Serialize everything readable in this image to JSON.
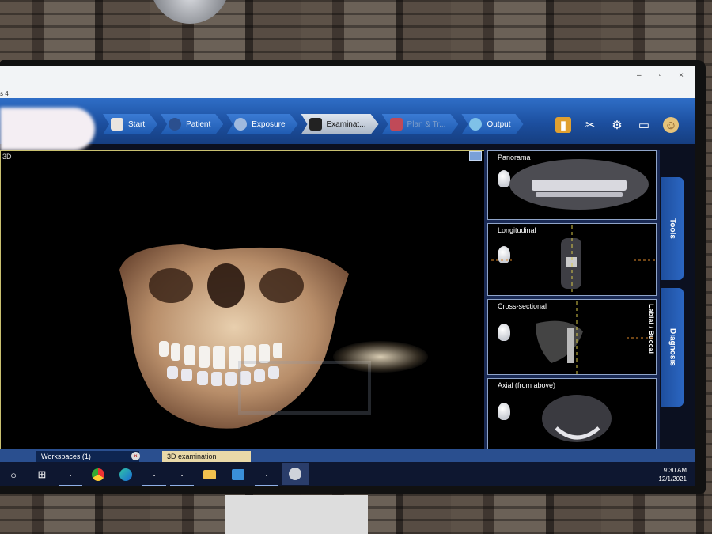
{
  "window": {
    "title_fragment": "s 4",
    "controls": [
      "–",
      "▫",
      "×"
    ]
  },
  "workflow": {
    "steps": [
      {
        "label": "Start",
        "icon": "house-icon",
        "state": "normal"
      },
      {
        "label": "Patient",
        "icon": "patient-icon",
        "state": "normal"
      },
      {
        "label": "Exposure",
        "icon": "exposure-icon",
        "state": "normal"
      },
      {
        "label": "Examinat...",
        "icon": "examination-icon",
        "state": "active"
      },
      {
        "label": "Plan & Tr...",
        "icon": "plan-icon",
        "state": "disabled"
      },
      {
        "label": "Output",
        "icon": "globe-icon",
        "state": "normal"
      }
    ]
  },
  "toolbar_icons": [
    "notes-icon",
    "tools-icon",
    "gear-icon",
    "screens-icon",
    "smiley-icon"
  ],
  "main_view": {
    "label": "3D"
  },
  "panels": [
    {
      "label": "Panorama"
    },
    {
      "label": "Longitudinal"
    },
    {
      "label": "Cross-sectional"
    },
    {
      "label": "Axial (from above)"
    }
  ],
  "side_tabs": {
    "tools": "Tools",
    "diagnosis": "Diagnosis",
    "labial": "Labial / Buccal"
  },
  "workspace_tabs": [
    {
      "label": "Workspaces (1)"
    },
    {
      "label": "3D examination"
    }
  ],
  "taskbar": {
    "time": "9:30 AM",
    "date": "12/1/2021",
    "items": [
      "search-icon",
      "taskview-icon",
      "app-icon",
      "chrome-icon",
      "edge-icon",
      "app-icon",
      "app-icon",
      "folder-icon",
      "monitor-app-icon",
      "app-icon",
      "dental-app-icon"
    ]
  },
  "colors": {
    "workflow_blue": "#1f5bb1",
    "active_step": "#c4cedb",
    "frame_accent": "#c9c070"
  }
}
